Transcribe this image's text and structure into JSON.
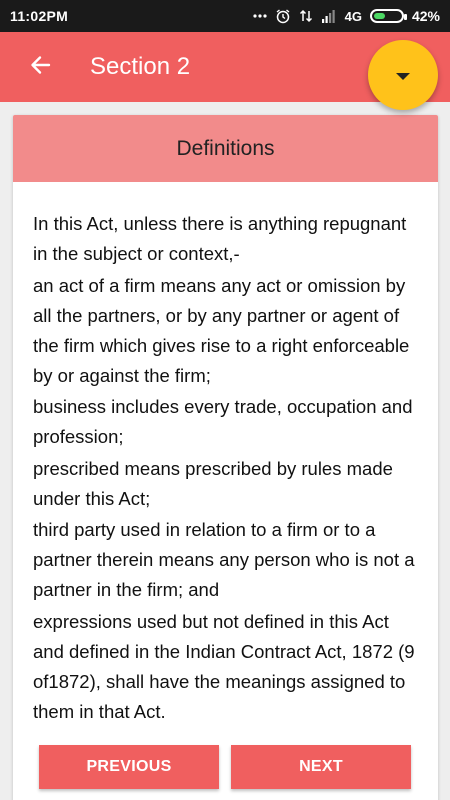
{
  "status_bar": {
    "time": "11:02PM",
    "network": "4G",
    "battery_text": "42%",
    "battery_level": 0.42,
    "battery_color": "#4cd964"
  },
  "app_bar": {
    "title": "Section 2",
    "back_icon": "arrow-left-icon",
    "background": "#f05f5f"
  },
  "fab": {
    "icon": "caret-down-icon",
    "color": "#ffc21a"
  },
  "card": {
    "header": "Definitions",
    "header_color": "#f28b8b",
    "paragraphs": [
      "In this Act, unless there is anything repugnant in the subject or context,-",
      "an act of a firm means any act or omission by all the partners, or by any partner or agent of the firm which gives rise to a right enforceable by or against the firm;",
      "business includes every trade, occupation and profession;",
      "prescribed means prescribed by rules made under this Act;",
      "third party used in relation to a firm or to a partner therein means any person who is not a partner in the firm; and",
      "expressions used but not defined in this Act and defined in the Indian Contract Act, 1872 (9 of1872), shall have the meanings assigned to them in that Act."
    ]
  },
  "nav": {
    "previous_label": "PREVIOUS",
    "next_label": "NEXT"
  }
}
